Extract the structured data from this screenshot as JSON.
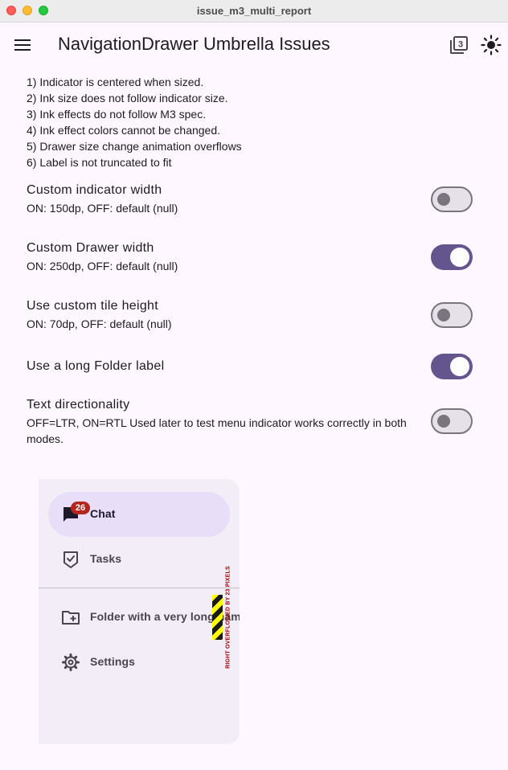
{
  "window": {
    "title": "issue_m3_multi_report"
  },
  "appbar": {
    "title": "NavigationDrawer Umbrella Issues",
    "menu_icon": "hamburger-menu-icon",
    "actions": [
      {
        "icon": "material-3-toggle-icon",
        "badge": "3"
      },
      {
        "icon": "brightness-icon"
      }
    ]
  },
  "issues": [
    "1) Indicator is centered when sized.",
    "2) Ink size does not follow indicator size.",
    "3) Ink effects do not follow M3 spec.",
    "4) Ink effect colors cannot be changed.",
    "5) Drawer size change animation overflows",
    "6) Label is not truncated to fit"
  ],
  "settings": [
    {
      "title": "Custom indicator width",
      "subtitle": "ON: 150dp, OFF: default (null)",
      "on": false
    },
    {
      "title": "Custom Drawer width",
      "subtitle": "ON: 250dp, OFF: default (null)",
      "on": true
    },
    {
      "title": "Use custom tile height",
      "subtitle": "ON: 70dp, OFF: default (null)",
      "on": false
    },
    {
      "title": "Use a long Folder label",
      "subtitle": "",
      "on": true
    },
    {
      "title": "Text directionality",
      "subtitle": "OFF=LTR, ON=RTL Used later to test menu indicator works correctly in both modes.",
      "on": false
    }
  ],
  "drawer": {
    "items": [
      {
        "label": "Chat",
        "icon": "chat-icon",
        "badge": "26",
        "selected": true
      },
      {
        "label": "Tasks",
        "icon": "task-check-icon",
        "selected": false
      },
      {
        "label": "Folder with a very long name",
        "icon": "folder-add-icon",
        "selected": false
      },
      {
        "label": "Settings",
        "icon": "gear-icon",
        "selected": false
      }
    ],
    "overflow_warning": "RIGHT OVERFLOWED BY 23 PIXELS"
  },
  "colors": {
    "background": "#fef7ff",
    "primary": "#65558f",
    "indicator": "#e8def8",
    "drawer": "#f3edf7",
    "badge": "#b3261e"
  }
}
